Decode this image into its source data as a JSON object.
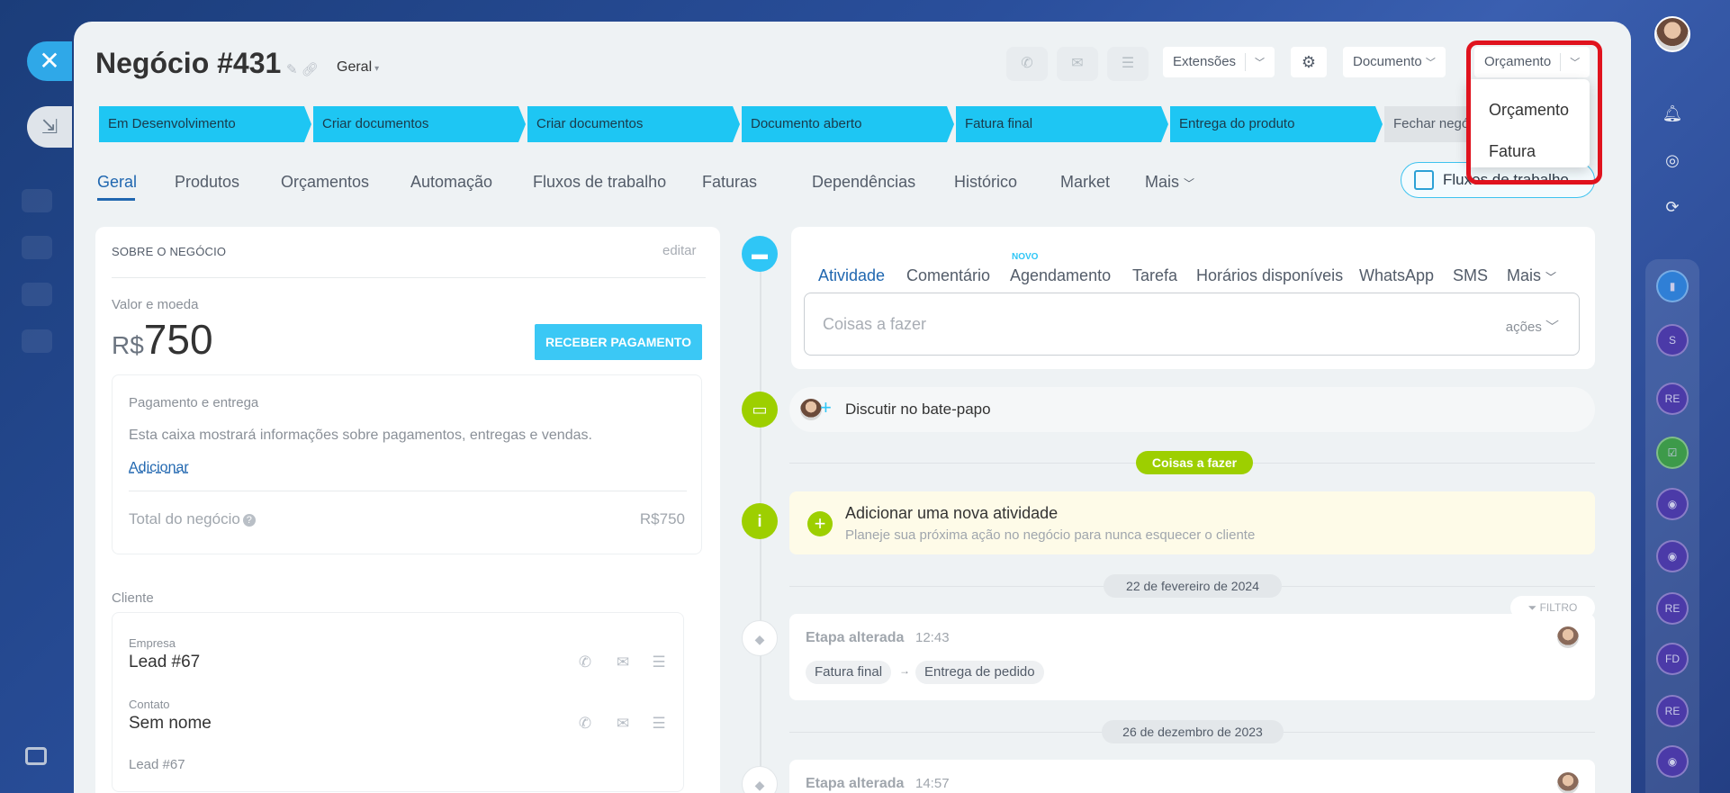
{
  "window": {
    "close_icon": "close-icon",
    "minimize_icon": "minimize-icon"
  },
  "header": {
    "title": "Negócio #431",
    "category": "Geral",
    "extensions_label": "Extensões",
    "document_label": "Documento",
    "estimate_label": "Orçamento"
  },
  "stages": [
    "Em Desenvolvimento",
    "Criar documentos",
    "Criar documentos",
    "Documento aberto",
    "Fatura final",
    "Entrega do produto",
    "Fechar negócio"
  ],
  "tabs": [
    "Geral",
    "Produtos",
    "Orçamentos",
    "Automação",
    "Fluxos de trabalho",
    "Faturas",
    "Dependências",
    "Histórico",
    "Market",
    "Mais"
  ],
  "workflows_button": "Fluxos de trabalho",
  "about": {
    "title": "SOBRE O NEGÓCIO",
    "edit": "editar",
    "value_label": "Valor e moeda",
    "currency": "R$",
    "amount": "750",
    "pay_button": "RECEBER PAGAMENTO",
    "payment_title": "Pagamento e entrega",
    "payment_desc": "Esta caixa mostrará informações sobre pagamentos, entregas e vendas.",
    "add_link": "Adicionar",
    "total_label": "Total do negócio",
    "total_value": "R$750"
  },
  "client": {
    "title": "Cliente",
    "company_label": "Empresa",
    "company_value": "Lead #67",
    "contact_label": "Contato",
    "contact_value": "Sem nome",
    "lead_ref": "Lead #67"
  },
  "activity": {
    "tabs": [
      "Atividade",
      "Comentário",
      "Agendamento",
      "Tarefa",
      "Horários disponíveis",
      "WhatsApp",
      "SMS",
      "Mais"
    ],
    "new_badge": "NOVO",
    "placeholder": "Coisas a fazer",
    "actions": "ações",
    "chat": "Discutir no bate-papo",
    "todo_pill": "Coisas a fazer",
    "new_title": "Adicionar uma nova atividade",
    "new_desc": "Planeje sua próxima ação no negócio para nunca esquecer o cliente",
    "date1": "22 de fevereiro de 2024",
    "filter": "FILTRO",
    "event1_title": "Etapa alterada",
    "event1_time": "12:43",
    "event1_from": "Fatura final",
    "event1_to": "Entrega de pedido",
    "date2": "26 de dezembro de 2023",
    "event2_title": "Etapa alterada",
    "event2_time": "14:57"
  },
  "dropdown": {
    "options": [
      "Orçamento",
      "Fatura"
    ]
  },
  "rail": {
    "circles": [
      "S",
      "RE",
      "RE",
      "FD",
      "RE"
    ]
  },
  "colors": {
    "stage": "#1ec6f3",
    "accent": "#2067b0",
    "green": "#9dcf00",
    "highlight": "#e0131e"
  }
}
